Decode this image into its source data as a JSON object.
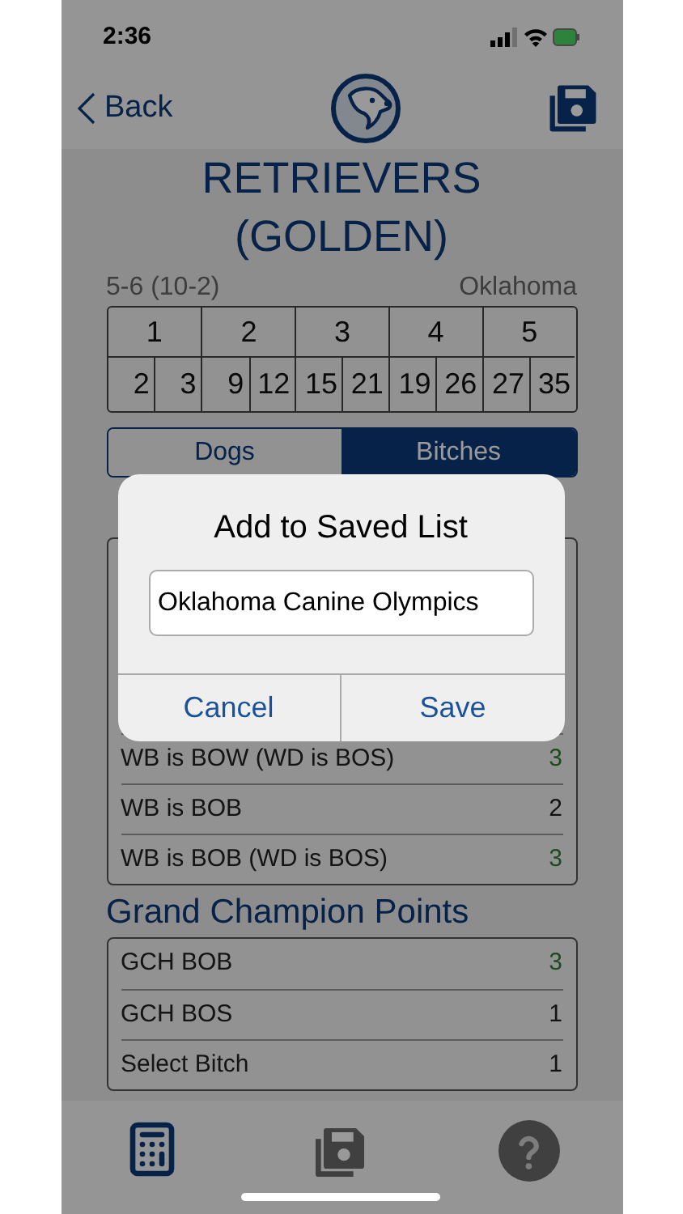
{
  "status_bar": {
    "time": "2:36"
  },
  "nav": {
    "back": "Back"
  },
  "breed_title": "RETRIEVERS (GOLDEN)",
  "division": "5-6 (10-2)",
  "state": "Oklahoma",
  "point_schedule": [
    {
      "points": "1",
      "counts": [
        "2",
        "3"
      ]
    },
    {
      "points": "2",
      "counts": [
        "9",
        "12"
      ]
    },
    {
      "points": "3",
      "counts": [
        "15",
        "21"
      ]
    },
    {
      "points": "4",
      "counts": [
        "19",
        "26"
      ]
    },
    {
      "points": "5",
      "counts": [
        "27",
        "35"
      ]
    }
  ],
  "segments": [
    {
      "label": "Dogs",
      "selected": false
    },
    {
      "label": "Bitches",
      "selected": true
    }
  ],
  "sections": [
    {
      "rows": [
        {
          "label": "WB is BOW (WD is BOS)",
          "value": "3",
          "highlighted": true
        },
        {
          "label": "WB is BOB",
          "value": "2",
          "highlighted": false
        },
        {
          "label": "WB is BOB (WD is BOS)",
          "value": "3",
          "highlighted": true
        }
      ]
    },
    {
      "title": "Grand Champion Points",
      "rows": [
        {
          "label": "GCH BOB",
          "value": "3",
          "highlighted": true
        },
        {
          "label": "GCH BOS",
          "value": "1",
          "highlighted": false
        },
        {
          "label": "Select Bitch",
          "value": "1",
          "highlighted": false
        }
      ]
    }
  ],
  "dialog": {
    "title": "Add to Saved List",
    "input_value": "Oklahoma Canine Olympics",
    "buttons": [
      "Cancel",
      "Save"
    ]
  },
  "tab_bar": [
    {
      "kind": "calculator",
      "selected": true
    },
    {
      "kind": "saved",
      "selected": false
    },
    {
      "kind": "help",
      "selected": false
    }
  ]
}
